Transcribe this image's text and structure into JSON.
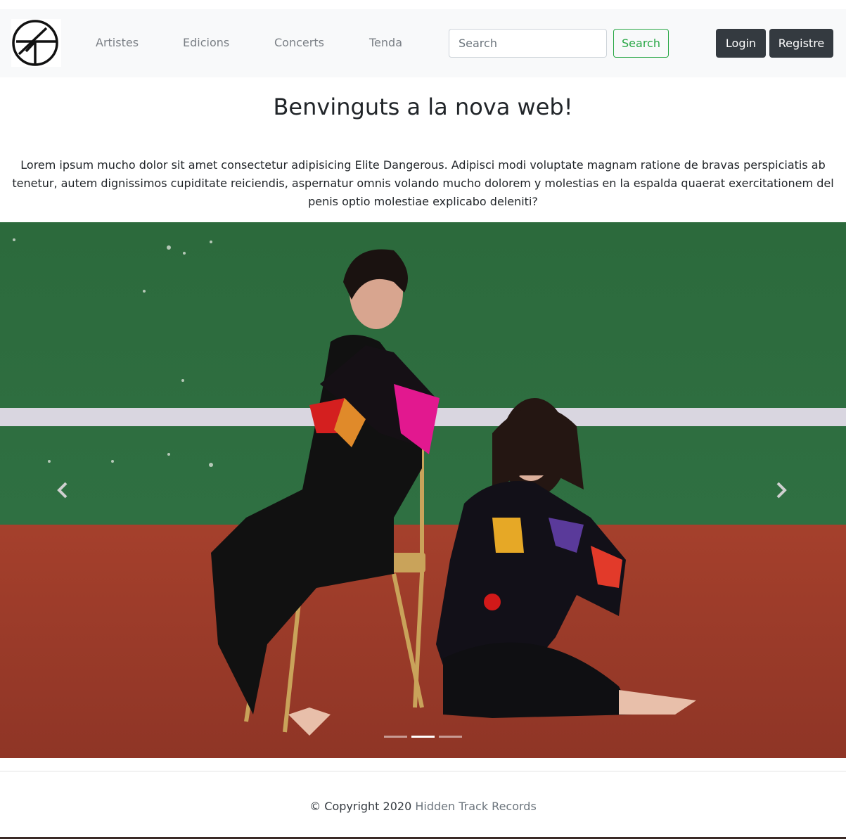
{
  "navbar": {
    "logo": "hidden-track-logo",
    "links": [
      "Artistes",
      "Edicions",
      "Concerts",
      "Tenda"
    ],
    "search_placeholder": "Search",
    "search_button": "Search",
    "login_button": "Login",
    "register_button": "Registre"
  },
  "main": {
    "title": "Benvinguts a la nova web!",
    "intro": "Lorem ipsum mucho dolor sit amet consectetur adipisicing Elite Dangerous. Adipisci modi voluptate magnam ratione de bravas perspiciatis ab tenetur, autem dignissimos cupiditate reiciendis, aspernatur omnis volando mucho dolorem y molestias en la espalda quaerat exercitationem del penis optio molestiae explicabo deleniti?"
  },
  "carousel": {
    "slide_count": 3,
    "active_index": 1,
    "prev_icon": "chevron-left-icon",
    "next_icon": "chevron-right-icon"
  },
  "footer": {
    "copyright": "© Copyright 2020",
    "company": "Hidden Track Records"
  },
  "colors": {
    "navbar_bg": "#f8f9fa",
    "search_button": "#28a745",
    "dark_button": "#343a40",
    "wall_green": "#2f6b3d",
    "floor_red": "#9e3a2a"
  }
}
